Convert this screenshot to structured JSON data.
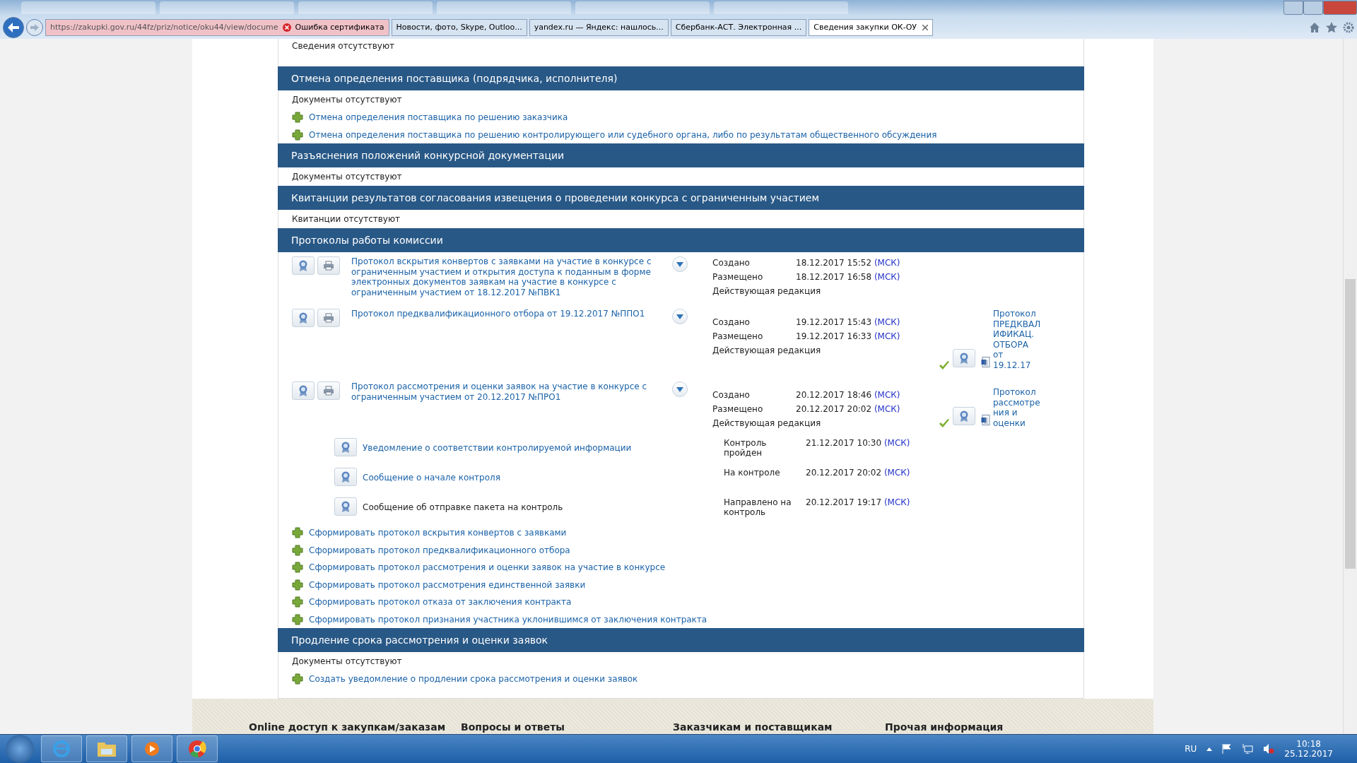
{
  "browser": {
    "address": {
      "url": "https://zakupki.gov.ru/44fz/priz/notice/oku44/view/docume",
      "cert_error": "Ошибка сертификата"
    },
    "tabs": [
      {
        "label": "Новости, фото, Skype, Outloo...",
        "selected": false
      },
      {
        "label": "yandex.ru — Яндекс: нашлось...",
        "selected": false
      },
      {
        "label": "Сбербанк-АСТ. Электронная ...",
        "selected": false
      },
      {
        "label": "Сведения закупки ОК-ОУ",
        "selected": true
      }
    ]
  },
  "top_note": "Сведения отсутствуют",
  "sections": [
    {
      "kind": "docs",
      "title": "Отмена определения поставщика (подрядчика, исполнителя)",
      "note": "Документы отсутствуют",
      "actions": [
        "Отмена определения поставщика по решению заказчика",
        "Отмена определения поставщика по решению контролирующего или судебного органа, либо по результатам общественного обсуждения"
      ]
    },
    {
      "kind": "docs",
      "title": "Разъяснения положений конкурсной документации",
      "note": "Документы отсутствуют"
    },
    {
      "kind": "docs",
      "title": "Квитанции результатов согласования извещения о проведении конкурса с ограниченным участием",
      "note": "Квитанции отсутствуют"
    },
    {
      "kind": "protocols",
      "title": "Протоколы работы комиссии",
      "protocols": [
        {
          "title": "Протокол вскрытия конвертов с заявками на участие в конкурсе с ограниченным участием и открытия доступа к поданным в форме электронных документов заявкам на участие в конкурсе с ограниченным участием от 18.12.2017 №ПВК1",
          "meta": [
            {
              "label": "Создано",
              "date": "18.12.2017 15:52",
              "tz": "(МСК)"
            },
            {
              "label": "Размещено",
              "date": "18.12.2017 16:58",
              "tz": "(МСК)"
            }
          ],
          "status": "Действующая редакция"
        },
        {
          "title": "Протокол предквалификационного отбора от 19.12.2017 №ППО1",
          "meta": [
            {
              "label": "Создано",
              "date": "19.12.2017 15:43",
              "tz": "(МСК)"
            },
            {
              "label": "Размещено",
              "date": "19.12.2017 16:33",
              "tz": "(МСК)"
            }
          ],
          "status": "Действующая редакция",
          "attachment": {
            "label": "Протокол ПРЕДКВАЛ ИФИКАЦ. ОТБОРА от 19.12.17",
            "verified": true
          }
        },
        {
          "title": "Протокол рассмотрения и оценки заявок на участие в конкурсе с ограниченным участием от 20.12.2017 №ПРО1",
          "meta": [
            {
              "label": "Создано",
              "date": "20.12.2017 18:46",
              "tz": "(МСК)"
            },
            {
              "label": "Размещено",
              "date": "20.12.2017 20:02",
              "tz": "(МСК)"
            }
          ],
          "status": "Действующая редакция",
          "attachment": {
            "label": "Протокол рассмотре ния и оценки",
            "verified": true
          },
          "events": [
            {
              "title": "Уведомление о соответствии контролируемой информации",
              "link": true,
              "label": "Контроль пройден",
              "date": "21.12.2017 10:30",
              "tz": "(МСК)"
            },
            {
              "title": "Сообщение о начале контроля",
              "link": true,
              "label": "На контроле",
              "date": "20.12.2017 20:02",
              "tz": "(МСК)"
            },
            {
              "title": "Сообщение об отправке пакета на контроль",
              "link": false,
              "label": "Направлено на контроль",
              "date": "20.12.2017 19:17",
              "tz": "(МСК)"
            }
          ]
        }
      ],
      "actions": [
        "Сформировать протокол вскрытия конвертов с заявками",
        "Сформировать протокол предквалификационного отбора",
        "Сформировать протокол рассмотрения и оценки заявок на участие в конкурсе",
        "Сформировать протокол рассмотрения единственной заявки",
        "Сформировать протокол отказа от заключения контракта",
        "Сформировать протокол признания участника уклонившимся от заключения контракта"
      ]
    },
    {
      "kind": "docs",
      "title": "Продление срока рассмотрения и оценки заявок",
      "note": "Документы отсутствуют",
      "actions": [
        "Создать уведомление о продлении срока рассмотрения и оценки заявок"
      ]
    }
  ],
  "footer": [
    "Online доступ к закупкам/заказам",
    "Вопросы и ответы",
    "Заказчикам и поставщикам",
    "Прочая информация"
  ],
  "taskbar": {
    "language": "RU",
    "time": "10:18",
    "date": "25.12.2017"
  }
}
